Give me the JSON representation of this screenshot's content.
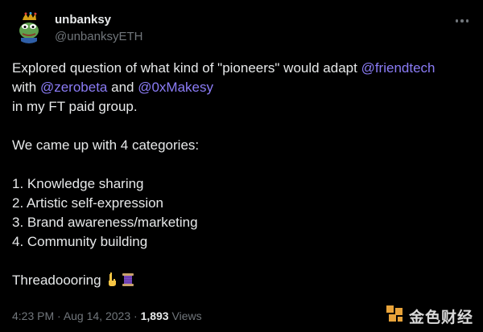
{
  "author": {
    "name": "unbanksy",
    "handle": "@unbanksyETH",
    "avatar_icon": "pepe-king-avatar-icon"
  },
  "tweet": {
    "line1_text": "Explored question of what kind of \"pioneers\" would adapt ",
    "line1_mention": "@friendtech",
    "line2_with": "with ",
    "line2_mention1": "@zerobeta",
    "line2_and": " and ",
    "line2_mention2": "@0xMakesy",
    "line3": "in my FT paid group.",
    "line4": "We came up with 4 categories:",
    "items": [
      "1. Knowledge sharing",
      "2. Artistic self-expression",
      "3. Brand awareness/marketing",
      "4. Community building"
    ],
    "closing": "Threadoooring"
  },
  "meta": {
    "time": "4:23 PM",
    "separator1": " · ",
    "date": "Aug 14, 2023",
    "separator2": " · ",
    "views_count": "1,893",
    "views_label": " Views"
  },
  "watermark": {
    "text": "金色财经"
  },
  "colors": {
    "background": "#000000",
    "text": "#e7e9ea",
    "muted": "#71767b",
    "mention": "#8b7cf6"
  }
}
